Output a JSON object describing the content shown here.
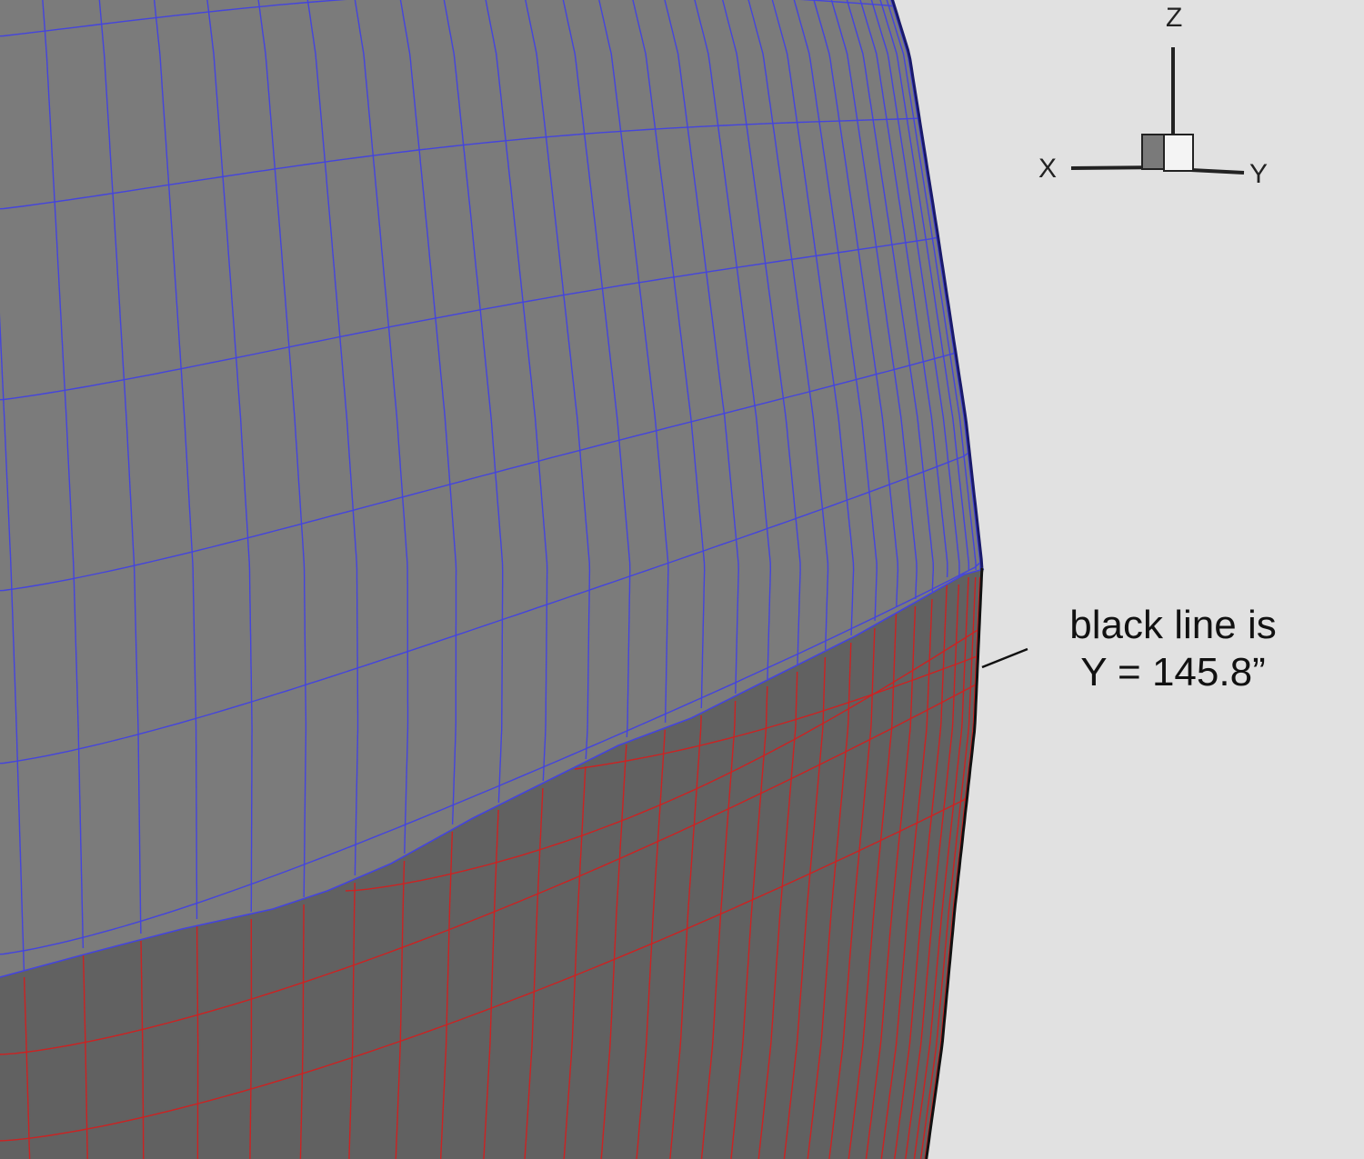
{
  "colors": {
    "background": "#e1e1e1",
    "upper_surface": "#7b7b7b",
    "lower_surface": "#616161",
    "upper_grid": "#4444dd",
    "lower_grid": "#cc2222",
    "edge_line": "#111111"
  },
  "orientation_triad": {
    "z_label": "Z",
    "x_label": "X",
    "y_label": "Y"
  },
  "annotation": {
    "line1": "black line is",
    "line2": "Y = 145.8”"
  }
}
